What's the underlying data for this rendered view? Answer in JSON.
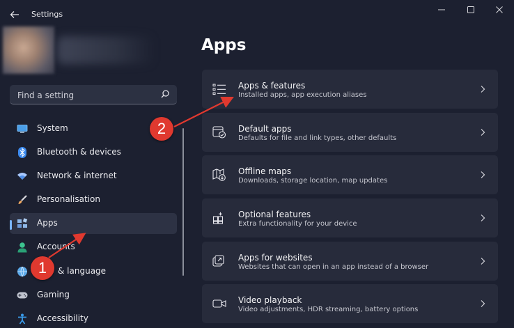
{
  "window": {
    "title": "Settings",
    "back_icon": "arrow-left-icon",
    "controls": [
      "minimize-icon",
      "maximize-icon",
      "close-icon"
    ]
  },
  "search": {
    "placeholder": "Find a setting",
    "icon": "search-icon"
  },
  "sidebar": {
    "items": [
      {
        "label": "System",
        "icon": "monitor-icon",
        "color": "#4a9ee8"
      },
      {
        "label": "Bluetooth & devices",
        "icon": "bluetooth-icon",
        "color": "#3d8bf0"
      },
      {
        "label": "Network & internet",
        "icon": "wifi-icon",
        "color": "#a9c9ff"
      },
      {
        "label": "Personalisation",
        "icon": "brush-icon",
        "color": "#f0a860"
      },
      {
        "label": "Apps",
        "icon": "apps-icon",
        "color": "#8fb8e8",
        "selected": true
      },
      {
        "label": "Accounts",
        "icon": "person-icon",
        "color": "#3cc38f"
      },
      {
        "label": "& language",
        "icon": "globe-icon",
        "color": "#5aa8e8"
      },
      {
        "label": "Gaming",
        "icon": "controller-icon",
        "color": "#c0c4cf"
      },
      {
        "label": "Accessibility",
        "icon": "accessibility-icon",
        "color": "#3a9ae8"
      }
    ]
  },
  "main": {
    "title": "Apps",
    "cards": [
      {
        "title": "Apps & features",
        "subtitle": "Installed apps, app execution aliases",
        "icon": "list-icon"
      },
      {
        "title": "Default apps",
        "subtitle": "Defaults for file and link types, other defaults",
        "icon": "default-apps-icon"
      },
      {
        "title": "Offline maps",
        "subtitle": "Downloads, storage location, map updates",
        "icon": "map-icon"
      },
      {
        "title": "Optional features",
        "subtitle": "Extra functionality for your device",
        "icon": "grid-plus-icon"
      },
      {
        "title": "Apps for websites",
        "subtitle": "Websites that can open in an app instead of a browser",
        "icon": "open-external-icon"
      },
      {
        "title": "Video playback",
        "subtitle": "Video adjustments, HDR streaming, battery options",
        "icon": "video-icon"
      }
    ]
  },
  "annotations": {
    "badge_1": "1",
    "badge_2": "2",
    "color": "#e0392f"
  },
  "colors": {
    "background": "#1c2030",
    "card": "#272b3b",
    "selected": "#2d3244",
    "accent": "#7ab6ff"
  }
}
